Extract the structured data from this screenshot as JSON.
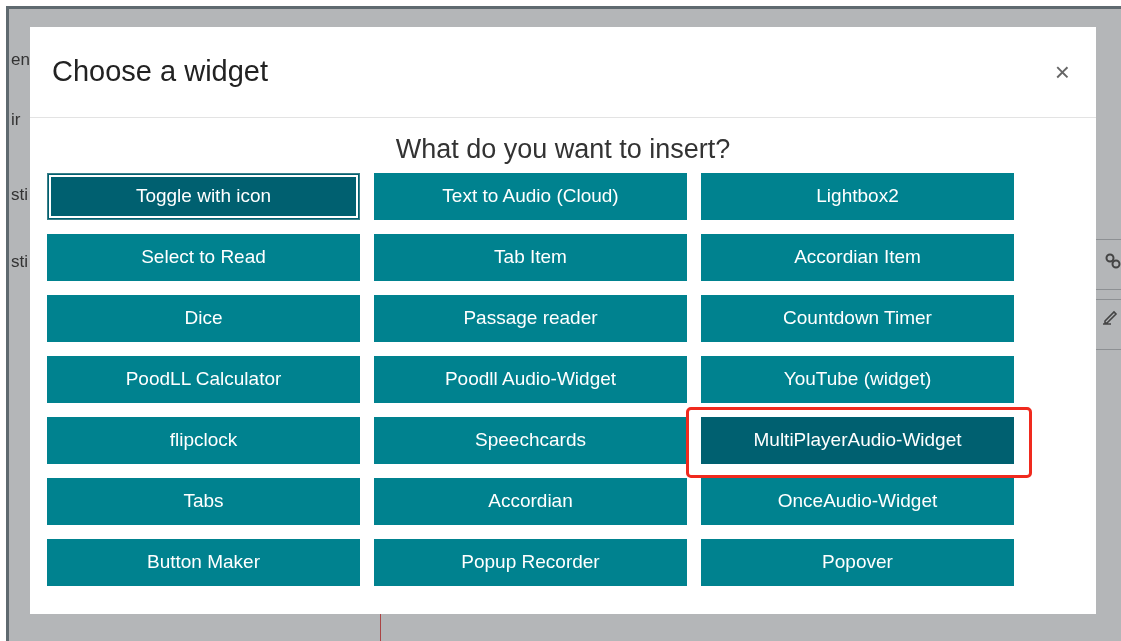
{
  "background": {
    "fragments": [
      "en",
      "ir",
      "sti",
      "sti"
    ]
  },
  "dialog": {
    "title": "Choose a widget",
    "close": "×",
    "prompt": "What do you want to insert?",
    "widgets": [
      {
        "label": "Toggle with icon",
        "active": true,
        "focused": true,
        "annotated": false
      },
      {
        "label": "Text to Audio (Cloud)",
        "active": false,
        "focused": false,
        "annotated": false
      },
      {
        "label": "Lightbox2",
        "active": false,
        "focused": false,
        "annotated": false
      },
      {
        "label": "Select to Read",
        "active": false,
        "focused": false,
        "annotated": false
      },
      {
        "label": "Tab Item",
        "active": false,
        "focused": false,
        "annotated": false
      },
      {
        "label": "Accordian Item",
        "active": false,
        "focused": false,
        "annotated": false
      },
      {
        "label": "Dice",
        "active": false,
        "focused": false,
        "annotated": false
      },
      {
        "label": "Passage reader",
        "active": false,
        "focused": false,
        "annotated": false
      },
      {
        "label": "Countdown Timer",
        "active": false,
        "focused": false,
        "annotated": false
      },
      {
        "label": "PoodLL Calculator",
        "active": false,
        "focused": false,
        "annotated": false
      },
      {
        "label": "Poodll Audio-Widget",
        "active": false,
        "focused": false,
        "annotated": false
      },
      {
        "label": "YouTube (widget)",
        "active": false,
        "focused": false,
        "annotated": false
      },
      {
        "label": "flipclock",
        "active": false,
        "focused": false,
        "annotated": false
      },
      {
        "label": "Speechcards",
        "active": false,
        "focused": false,
        "annotated": false
      },
      {
        "label": "MultiPlayerAudio-Widget",
        "active": true,
        "focused": false,
        "annotated": true
      },
      {
        "label": "Tabs",
        "active": false,
        "focused": false,
        "annotated": false
      },
      {
        "label": "Accordian",
        "active": false,
        "focused": false,
        "annotated": false
      },
      {
        "label": "OnceAudio-Widget",
        "active": false,
        "focused": false,
        "annotated": false
      },
      {
        "label": "Button Maker",
        "active": false,
        "focused": false,
        "annotated": false
      },
      {
        "label": "Popup Recorder",
        "active": false,
        "focused": false,
        "annotated": false
      },
      {
        "label": "Popover",
        "active": false,
        "focused": false,
        "annotated": false
      }
    ]
  }
}
